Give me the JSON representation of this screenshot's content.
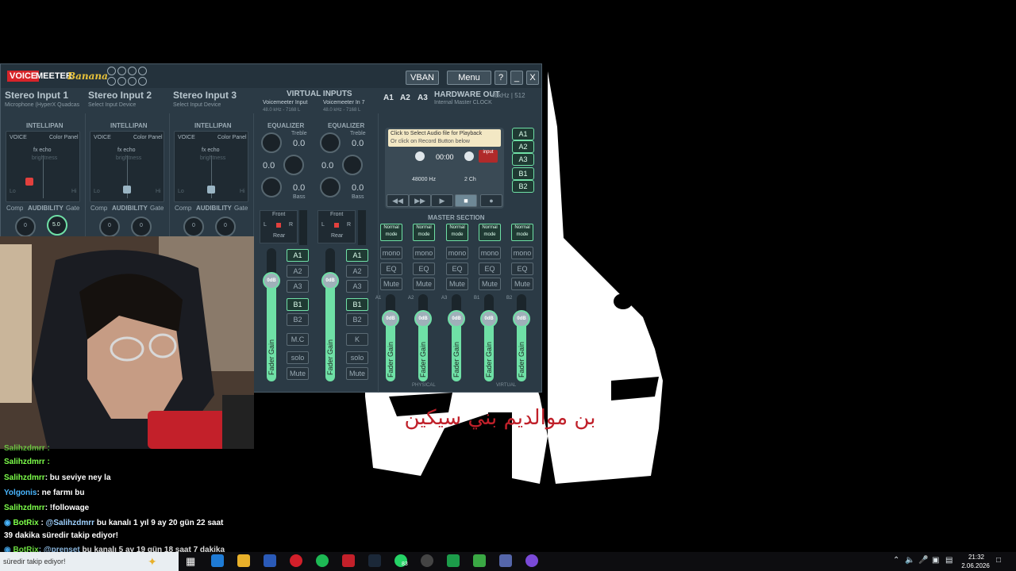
{
  "voicemeeter": {
    "logo_voice": "VOICE",
    "logo_meter": "MEETER",
    "logo_banana": "Banana",
    "vban": "VBAN",
    "menu": "Menu",
    "help": "?",
    "minimize": "_",
    "close": "X",
    "inputs": [
      {
        "name": "Stereo Input 1",
        "device": "Microphone (HyperX Quadcas"
      },
      {
        "name": "Stereo Input 2",
        "device": "Select Input Device"
      },
      {
        "name": "Stereo Input 3",
        "device": "Select Input Device"
      }
    ],
    "virtual_inputs": "VIRTUAL INPUTS",
    "vi1_name": "Voicemeeter Input",
    "vi2_name": "Voicemeeter In 7",
    "vi1_sub": "48.0 kHz - 7168 L",
    "vi2_sub": "48.0 kHz - 7168 L",
    "a1": "A1",
    "a2": "A2",
    "a3": "A3",
    "hardware_out": "HARDWARE OUT",
    "hardware_rate": "48kHz | 512",
    "hardware_clock": "Internal Master CLOCK",
    "intellipan": "INTELLIPAN",
    "voice": "VOICE",
    "color_panel": "Color Panel",
    "fx_echo": "fx echo",
    "brightness": "brightness",
    "lo": "Lo",
    "hi": "Hi",
    "comp": "Comp",
    "audibility": "AUDIBILITY",
    "gate": "Gate",
    "knob_left": "0",
    "knob_mid": "5.0",
    "knob_right": "0",
    "equalizer": "EQUALIZER",
    "treble": "Treble",
    "bass": "Bass",
    "eq_val": "0.0",
    "front": "Front",
    "rear": "Rear",
    "l": "L",
    "r": "R",
    "strip_buttons": [
      "A1",
      "A2",
      "A3",
      "B1",
      "B2"
    ],
    "mc": "M.C",
    "k": "K",
    "solo": "solo",
    "mute": "Mute",
    "odb": "0dB",
    "fader_gain": "Fader Gain",
    "tape_line1": "Click to Select Audio file for Playback",
    "tape_line2": "Or click on Record Button below",
    "tape_time": "00:00",
    "tape_input": "input",
    "tape_rate": "48000 Hz",
    "tape_ch": "2 Ch",
    "hw_buttons": [
      "A1",
      "A2",
      "A3",
      "B1",
      "B2"
    ],
    "master_section": "MASTER SECTION",
    "normal_mode": "Normal mode",
    "mono": "mono",
    "eq": "EQ",
    "bus_labels": [
      "A1",
      "A2",
      "A3",
      "B1",
      "B2"
    ],
    "physical": "PHYSICAL",
    "virtual": "VIRTUAL"
  },
  "wallpaper_text": "بن موالديم بني سيكين",
  "chat": [
    {
      "nick": "Salihzdmrr",
      "msg": ": bu seviye ney la"
    },
    {
      "nick": "Yolgonis",
      "msg": ": ne farmı bu"
    },
    {
      "nick": "Salihzdmrr",
      "msg": ": !followage"
    },
    {
      "nick": "BotRix",
      "mention": "@Salihzdmrr",
      "msg": " bu kanalı 1 yıl 9 ay 20 gün 22 saat"
    },
    {
      "msg": "39 dakika süredir takip ediyor!"
    },
    {
      "nick": "BotRix",
      "mention": ": @prenset",
      "msg": " bu kanalı 5 ay 19 gün 18 saat 7 dakika"
    },
    {
      "msg": "süredir takip ediyor!"
    }
  ],
  "chat_top": "Salihzdmrr :",
  "chat_top2": "Salihzdmrr :",
  "taskbar": {
    "time": "21:32",
    "date": "2.06.2026",
    "badge": "83"
  }
}
